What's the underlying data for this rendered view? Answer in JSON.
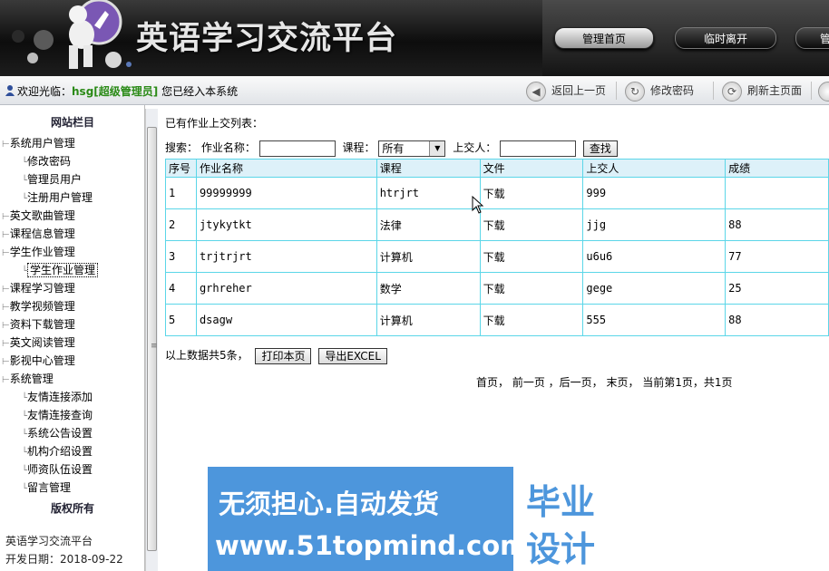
{
  "header": {
    "title": "英语学习交流平台",
    "nav": [
      "管理首页",
      "临时离开",
      "管"
    ]
  },
  "toolbar": {
    "welcome_prefix": "欢迎光临：",
    "username": "hsg[超级管理员]",
    "welcome_suffix": " 您已经入本系统",
    "buttons": [
      "返回上一页",
      "修改密码",
      "刷新主页面"
    ]
  },
  "sidebar": {
    "title": "网站栏目",
    "footer_title": "版权所有",
    "groups": [
      {
        "label": "系统用户管理",
        "children": [
          "修改密码",
          "管理员用户",
          "注册用户管理"
        ]
      },
      {
        "label": "英文歌曲管理",
        "children": []
      },
      {
        "label": "课程信息管理",
        "children": []
      },
      {
        "label": "学生作业管理",
        "children": [
          "学生作业管理"
        ]
      },
      {
        "label": "课程学习管理",
        "children": []
      },
      {
        "label": "教学视频管理",
        "children": []
      },
      {
        "label": "资料下载管理",
        "children": []
      },
      {
        "label": "英文阅读管理",
        "children": []
      },
      {
        "label": "影视中心管理",
        "children": []
      },
      {
        "label": "系统管理",
        "children": [
          "友情连接添加",
          "友情连接查询",
          "系统公告设置",
          "机构介绍设置",
          "师资队伍设置",
          "留言管理"
        ]
      }
    ],
    "info_name": "英语学习交流平台",
    "info_date_label": "开发日期：",
    "info_date": "2018-09-22"
  },
  "main": {
    "list_title": "已有作业上交列表：",
    "search": {
      "label": "搜索：",
      "name_label": "作业名称：",
      "course_label": "课程：",
      "course_value": "所有",
      "submitter_label": "上交人：",
      "button": "查找"
    },
    "table": {
      "headers": [
        "序号",
        "作业名称",
        "课程",
        "文件",
        "上交人",
        "成绩"
      ],
      "rows": [
        [
          "1",
          "99999999",
          "htrjrt",
          "下载",
          "999",
          ""
        ],
        [
          "2",
          "jtykytkt",
          "法律",
          "下载",
          "jjg",
          "88"
        ],
        [
          "3",
          "trjtrjrt",
          "计算机",
          "下载",
          "u6u6",
          "77"
        ],
        [
          "4",
          "grhreher",
          "数学",
          "下载",
          "gege",
          "25"
        ],
        [
          "5",
          "dsagw",
          "计算机",
          "下载",
          "555",
          "88"
        ]
      ]
    },
    "summary": "以上数据共5条，",
    "print_button": "打印本页",
    "export_button": "导出EXCEL",
    "pager": "首页，  前一页 ，后一页，  末页，  当前第1页，共1页"
  },
  "watermark": {
    "line1": "无须担心.自动发货",
    "line2": "www.51topmind.com",
    "box_line1": "毕业",
    "box_line2": "设计"
  },
  "colors": {
    "header_bg": "#1a1a1a",
    "username": "#2a8a16",
    "table_border": "#5bd6e8",
    "table_header_bg": "#ddf1f9",
    "watermark_bg": "#4d96dc"
  }
}
